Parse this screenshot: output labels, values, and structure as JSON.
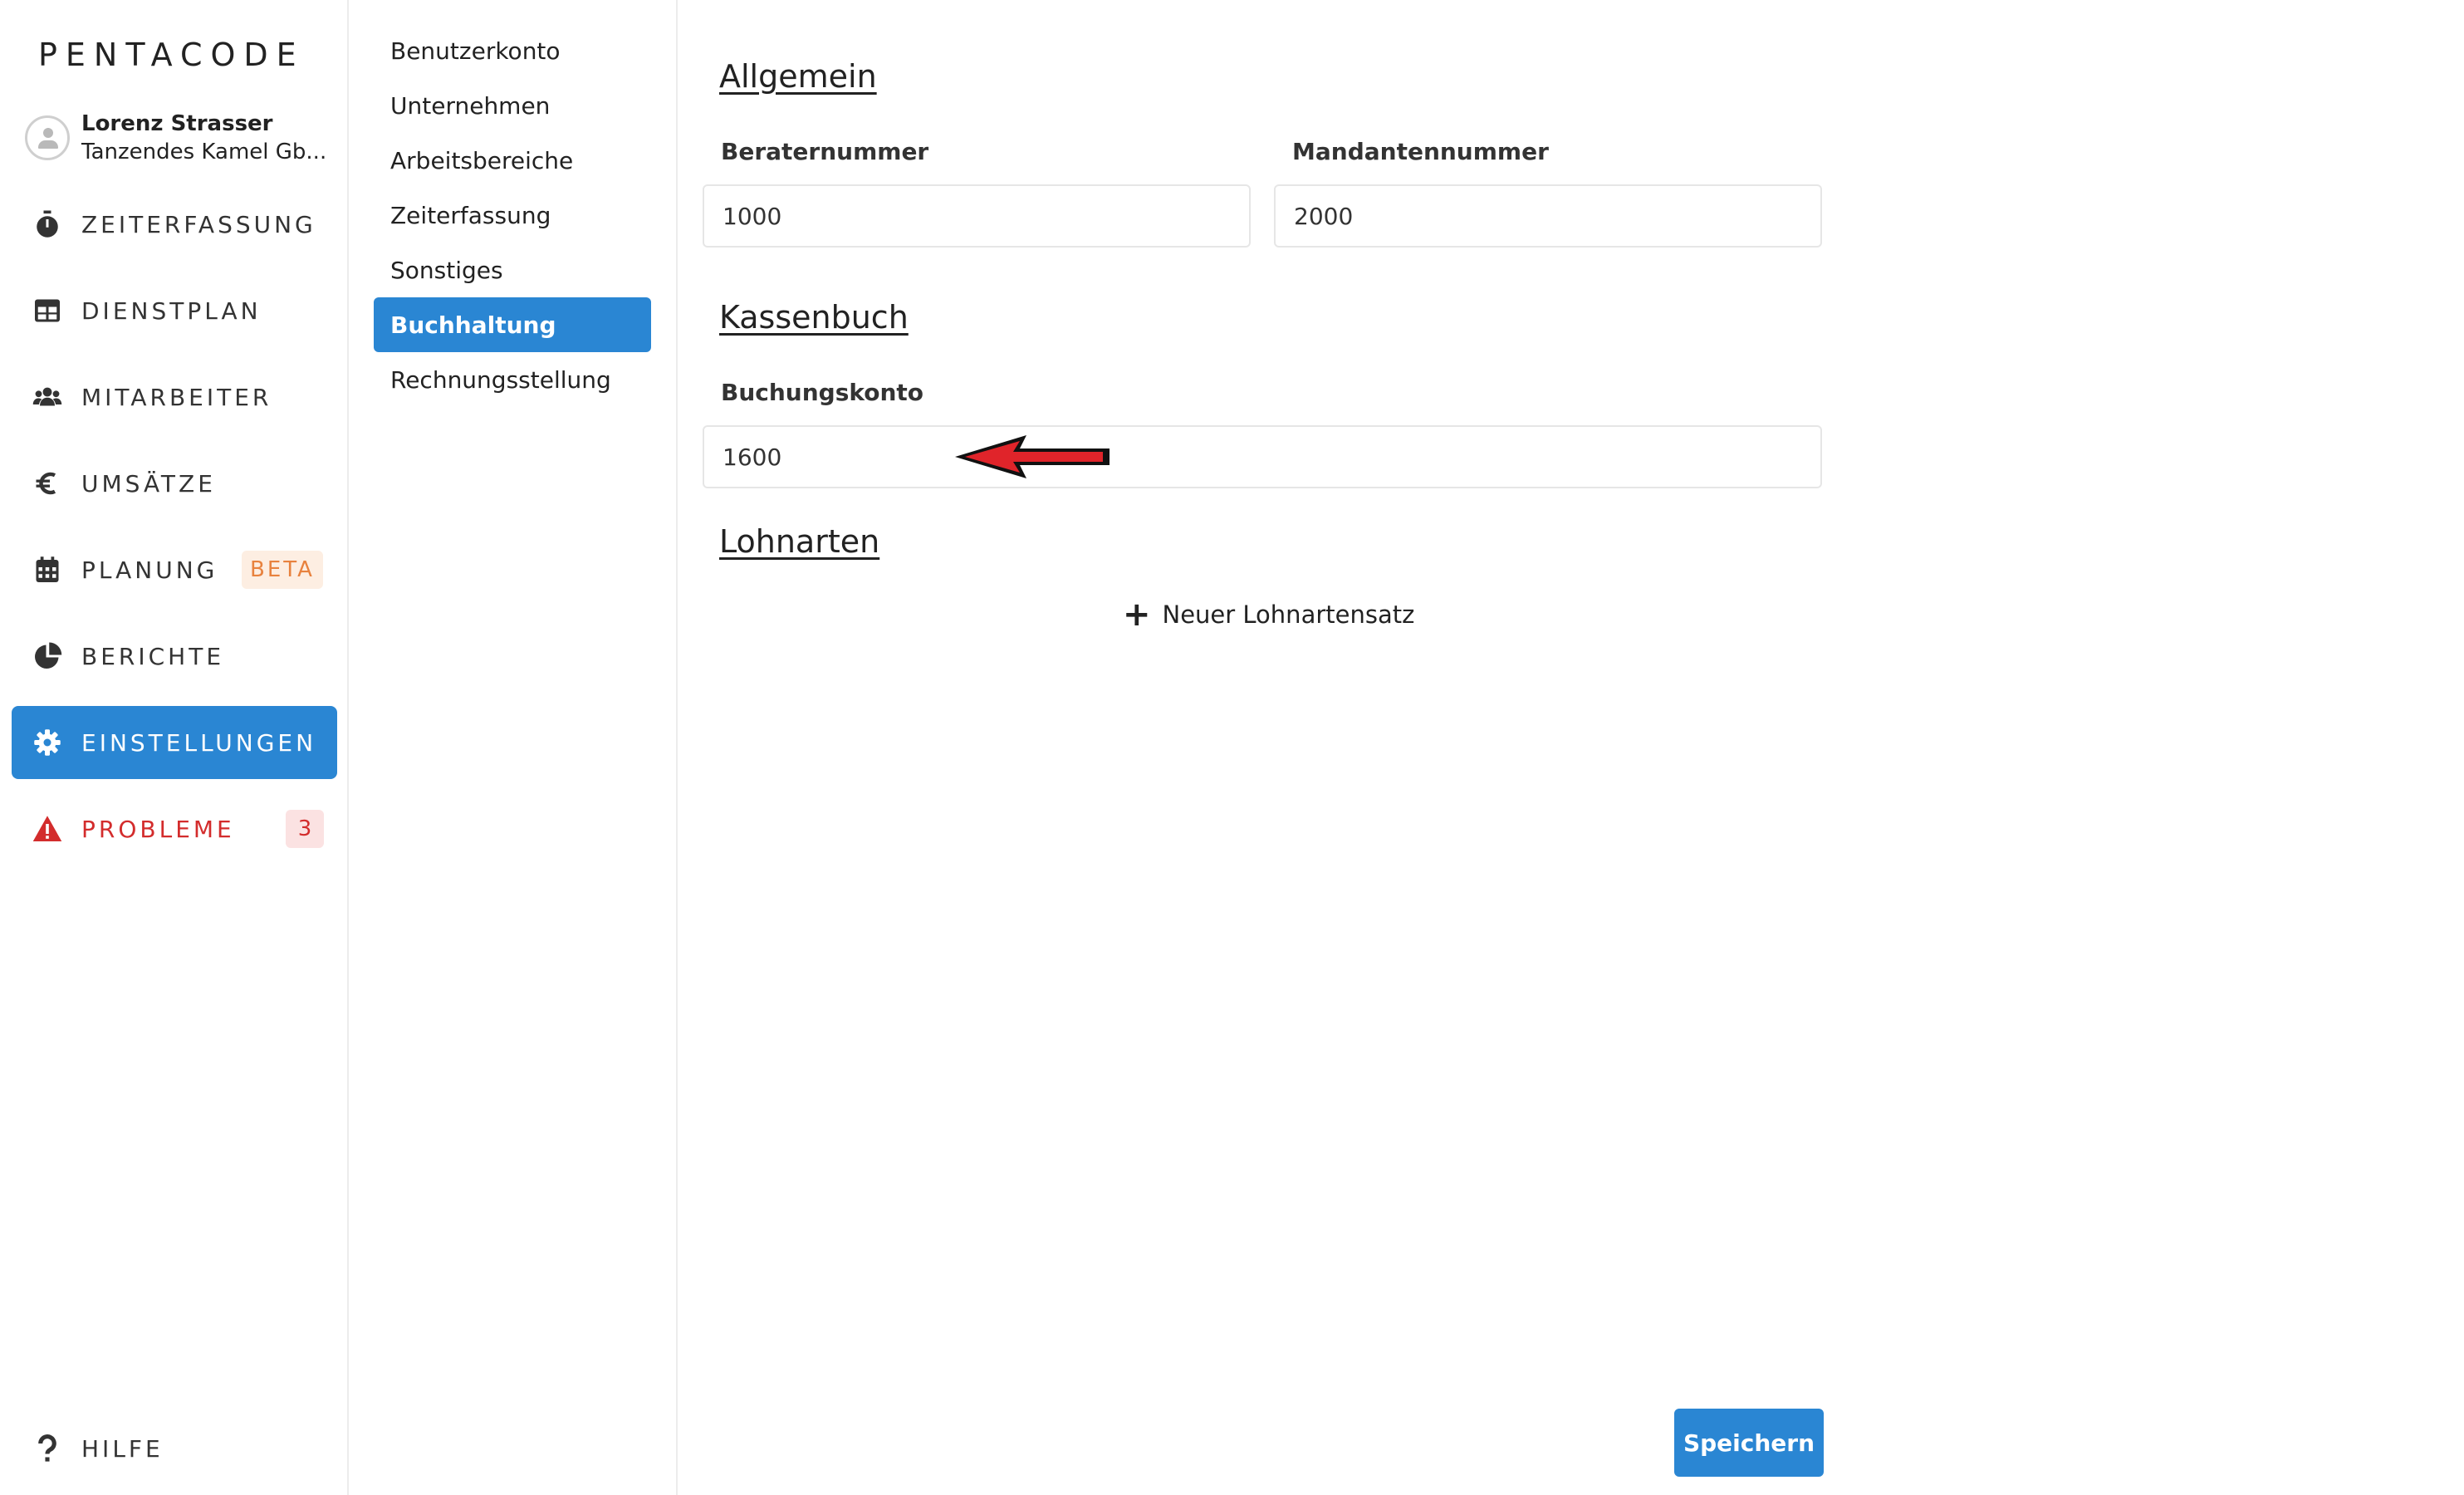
{
  "brand": {
    "logo": "PENTACODE"
  },
  "user": {
    "name": "Lorenz Strasser",
    "company": "Tanzendes Kamel Gb..."
  },
  "nav": {
    "zeiterfassung": "ZEITERFASSUNG",
    "dienstplan": "DIENSTPLAN",
    "mitarbeiter": "MITARBEITER",
    "umsaetze": "UMSÄTZE",
    "planung": "PLANUNG",
    "planung_badge": "BETA",
    "berichte": "BERICHTE",
    "einstellungen": "EINSTELLUNGEN",
    "probleme": "PROBLEME",
    "probleme_count": "3",
    "hilfe": "HILFE"
  },
  "settings_nav": {
    "benutzerkonto": "Benutzerkonto",
    "unternehmen": "Unternehmen",
    "arbeitsbereiche": "Arbeitsbereiche",
    "zeiterfassung": "Zeiterfassung",
    "sonstiges": "Sonstiges",
    "buchhaltung": "Buchhaltung",
    "rechnungsstellung": "Rechnungsstellung",
    "active": "Buchhaltung"
  },
  "main": {
    "allgemein": {
      "title": "Allgemein",
      "beraternummer_label": "Beraternummer",
      "beraternummer_value": "1000",
      "mandantennummer_label": "Mandantennummer",
      "mandantennummer_value": "2000"
    },
    "kassenbuch": {
      "title": "Kassenbuch",
      "buchungskonto_label": "Buchungskonto",
      "buchungskonto_value": "1600"
    },
    "lohnarten": {
      "title": "Lohnarten",
      "add_label": "Neuer Lohnartensatz"
    },
    "save_label": "Speichern"
  },
  "colors": {
    "accent": "#2a86d3",
    "danger": "#d32c2c",
    "beta": "#e8823e",
    "annotation_arrow": "#e0242a"
  },
  "icons": {
    "zeiterfassung": "stopwatch-icon",
    "dienstplan": "table-icon",
    "mitarbeiter": "users-icon",
    "umsaetze": "euro-icon",
    "planung": "calendar-icon",
    "berichte": "pie-chart-icon",
    "einstellungen": "gear-icon",
    "probleme": "warning-icon",
    "hilfe": "question-icon",
    "add": "plus-icon"
  }
}
